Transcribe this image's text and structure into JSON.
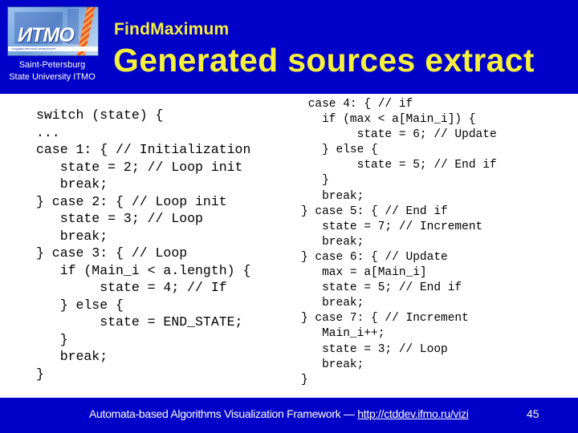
{
  "header": {
    "logo_text": "ИТМО",
    "logo_band_text": "государственный университет",
    "university_line1": "Saint-Petersburg",
    "university_line2": "State University ITMO",
    "subtitle": "FindMaximum",
    "title": "Generated sources extract"
  },
  "code": {
    "left": "switch (state) {\n...\ncase 1: { // Initialization\n   state = 2; // Loop init\n   break;\n} case 2: { // Loop init\n   state = 3; // Loop\n   break;\n} case 3: { // Loop\n   if (Main_i < a.length) {\n        state = 4; // If\n   } else {\n        state = END_STATE;\n   }\n   break;\n}",
    "right": " case 4: { // if\n   if (max < a[Main_i]) {\n        state = 6; // Update\n   } else {\n        state = 5; // End if\n   }\n   break;\n} case 5: { // End if\n   state = 7; // Increment\n   break;\n} case 6: { // Update\n   max = a[Main_i]\n   state = 5; // End if\n   break;\n} case 7: { // Increment\n   Main_i++;\n   state = 3; // Loop\n   break;\n}"
  },
  "footer": {
    "text": "Automata-based Algorithms Visualization Framework — ",
    "link": "http://ctddev.ifmo.ru/vizi",
    "page_number": "45"
  },
  "colors": {
    "background_blue": "#0000c8",
    "title_yellow": "#f5f03a"
  }
}
